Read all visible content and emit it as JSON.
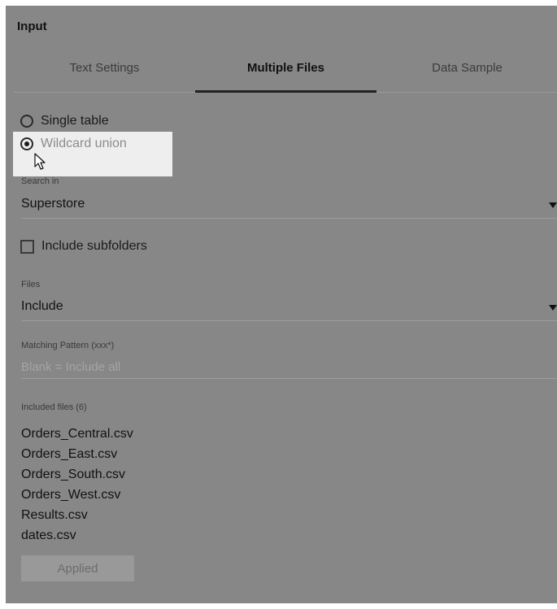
{
  "panel": {
    "title": "Input"
  },
  "tabs": [
    {
      "label": "Text Settings",
      "active": false
    },
    {
      "label": "Multiple Files",
      "active": true
    },
    {
      "label": "Data Sample",
      "active": false
    }
  ],
  "union_mode": {
    "options": [
      {
        "label": "Single table",
        "selected": false
      },
      {
        "label": "Wildcard union",
        "selected": true
      }
    ]
  },
  "search_in": {
    "label": "Search in",
    "value": "Superstore"
  },
  "subfolders": {
    "label": "Include subfolders",
    "checked": false
  },
  "files_filter": {
    "label": "Files",
    "value": "Include"
  },
  "matching_pattern": {
    "label": "Matching Pattern (xxx*)",
    "placeholder": "Blank = Include all",
    "value": ""
  },
  "included_files": {
    "label": "Included files (6)",
    "items": [
      "Orders_Central.csv",
      "Orders_East.csv",
      "Orders_South.csv",
      "Orders_West.csv",
      "Results.csv",
      "dates.csv"
    ]
  },
  "applied_button": {
    "label": "Applied",
    "disabled": true
  },
  "colors": {
    "panel_background": "#878787",
    "highlight_background": "#eeeeee",
    "active_tab_underline": "#222222"
  },
  "icons": {
    "cursor": "mouse-pointer-icon",
    "dropdown": "caret-down-icon"
  }
}
